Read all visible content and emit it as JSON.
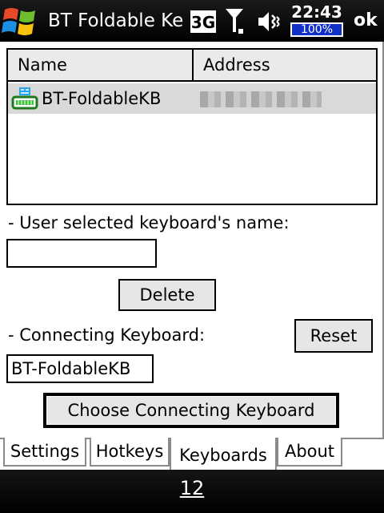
{
  "titlebar": {
    "title": "BT Foldable Keyboard",
    "network_icon": "3g-icon",
    "signal_icon": "signal-antenna-icon",
    "volume_icon": "speaker-vibrate-icon",
    "clock": "22:43",
    "battery": "100%",
    "ok_label": "ok"
  },
  "listview": {
    "columns": [
      "Name",
      "Address"
    ],
    "rows": [
      {
        "name": "BT-FoldableKB",
        "address_obscured": true,
        "icon": "keyboard-device-icon"
      }
    ]
  },
  "form": {
    "user_name_label": "- User selected keyboard's name:",
    "user_name_value": "",
    "delete_label": "Delete",
    "connecting_label": "- Connecting Keyboard:",
    "reset_label": "Reset",
    "connecting_value": "BT-FoldableKB",
    "choose_label": "Choose Connecting Keyboard"
  },
  "tabs": [
    {
      "label": "Settings",
      "active": false
    },
    {
      "label": "Hotkeys",
      "active": false
    },
    {
      "label": "Keyboards",
      "active": true
    },
    {
      "label": "About",
      "active": false
    }
  ],
  "softkeys": {
    "center_label": "12"
  },
  "colors": {
    "battery_fill": "#1030c8",
    "selected_row": "#d9d9d9"
  }
}
